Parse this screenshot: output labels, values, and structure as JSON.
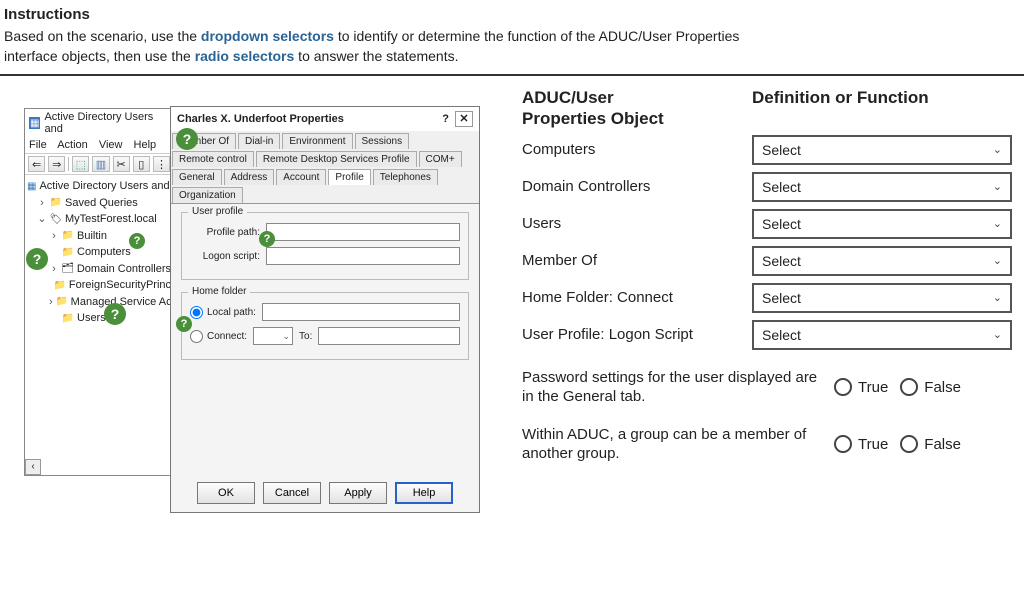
{
  "instructions": {
    "heading": "Instructions",
    "line1a": "Based on the scenario, use the ",
    "kw1": "dropdown selectors",
    "line1b": " to identify or determine the function of the ADUC/User Properties",
    "line2a": "interface objects, then use the ",
    "kw2": "radio selectors",
    "line2b": " to answer the statements."
  },
  "aduc": {
    "title": "Active Directory Users and",
    "menus": {
      "file": "File",
      "action": "Action",
      "view": "View",
      "help": "Help"
    },
    "tree": {
      "root": "Active Directory Users and C",
      "saved": "Saved Queries",
      "domain": "MyTestForest.local",
      "builtin": "Builtin",
      "computers": "Computers",
      "dcs": "Domain Controllers",
      "fsp": "ForeignSecurityPrinc",
      "msa": "Managed Service Ac",
      "users": "Users"
    }
  },
  "dlg": {
    "title": "Charles X. Underfoot Properties",
    "help_glyph": "?",
    "tabs": {
      "memberof": "Member Of",
      "dialin": "Dial-in",
      "env": "Environment",
      "sessions": "Sessions",
      "remote": "Remote control",
      "rdsp": "Remote Desktop Services Profile",
      "com": "COM+",
      "general": "General",
      "address": "Address",
      "account": "Account",
      "profile": "Profile",
      "tele": "Telephones",
      "org": "Organization"
    },
    "userprofile": {
      "legend": "User profile",
      "path": "Profile path:",
      "logon": "Logon script:"
    },
    "homefolder": {
      "legend": "Home folder",
      "local": "Local path:",
      "connect": "Connect:",
      "to": "To:"
    },
    "buttons": {
      "ok": "OK",
      "cancel": "Cancel",
      "apply": "Apply",
      "help": "Help"
    }
  },
  "quiz": {
    "head1a": "ADUC/User",
    "head1b": "Properties Object",
    "head2": "Definition or Function",
    "rows": {
      "computers": "Computers",
      "dcs": "Domain Controllers",
      "users": "Users",
      "memberof": "Member Of",
      "hfc": "Home Folder: Connect",
      "upls": "User Profile: Logon Script"
    },
    "select_placeholder": "Select",
    "stmt1": "Password settings for the user displayed are in the General tab.",
    "stmt2": "Within ADUC, a group can be a member of another group.",
    "true": "True",
    "false": "False"
  }
}
